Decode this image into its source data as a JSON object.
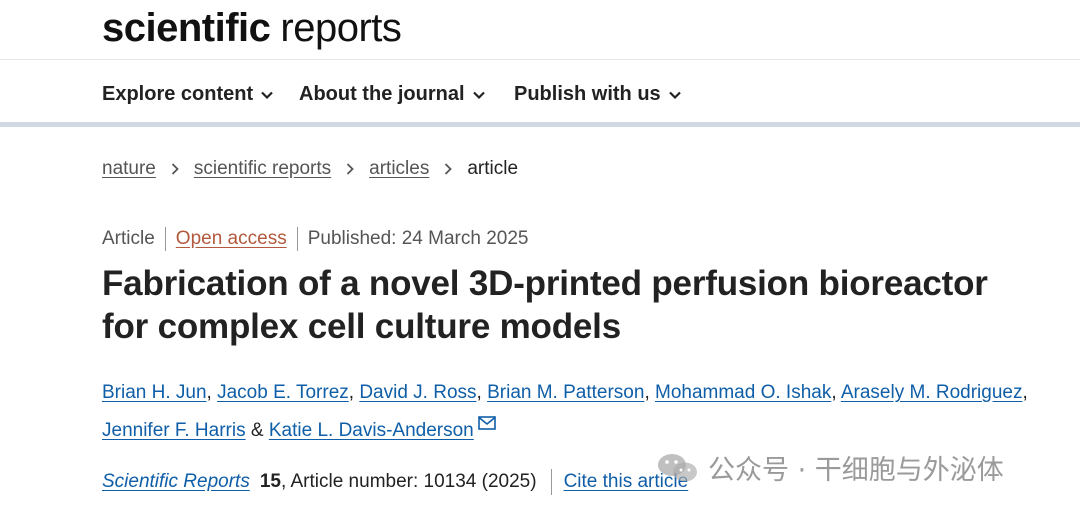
{
  "logo": {
    "bold": "scientific",
    "light": "reports"
  },
  "nav": [
    {
      "label": "Explore content"
    },
    {
      "label": "About the journal"
    },
    {
      "label": "Publish with us"
    }
  ],
  "breadcrumb": {
    "items": [
      "nature",
      "scientific reports",
      "articles"
    ],
    "current": "article"
  },
  "meta": {
    "type": "Article",
    "access": "Open access",
    "published": "Published: 24 March 2025"
  },
  "title": "Fabrication of a novel 3D-printed perfusion bioreactor for complex cell culture models",
  "authors": [
    "Brian H. Jun",
    "Jacob E. Torrez",
    "David J. Ross",
    "Brian M. Patterson",
    "Mohammad O. Ishak",
    "Arasely M. Rodriguez",
    "Jennifer F. Harris",
    "Katie L. Davis-Anderson"
  ],
  "author_separators": {
    "comma": ",",
    "and": "&"
  },
  "journal": {
    "name": "Scientific Reports",
    "volume": "15",
    "article_info": ", Article number: 10134 (2025)",
    "cite": "Cite this article"
  },
  "watermark": {
    "text": "公众号 · 干细胞与外泌体"
  },
  "colors": {
    "link": "#0f5ea8",
    "open_access": "#b3593d",
    "nav_border": "#cfd8e3"
  },
  "icons": {
    "nav_dropdown": "chevron-down-icon",
    "breadcrumb": "chevron-right-icon",
    "contact": "mail-icon",
    "watermark": "wechat-icon"
  }
}
